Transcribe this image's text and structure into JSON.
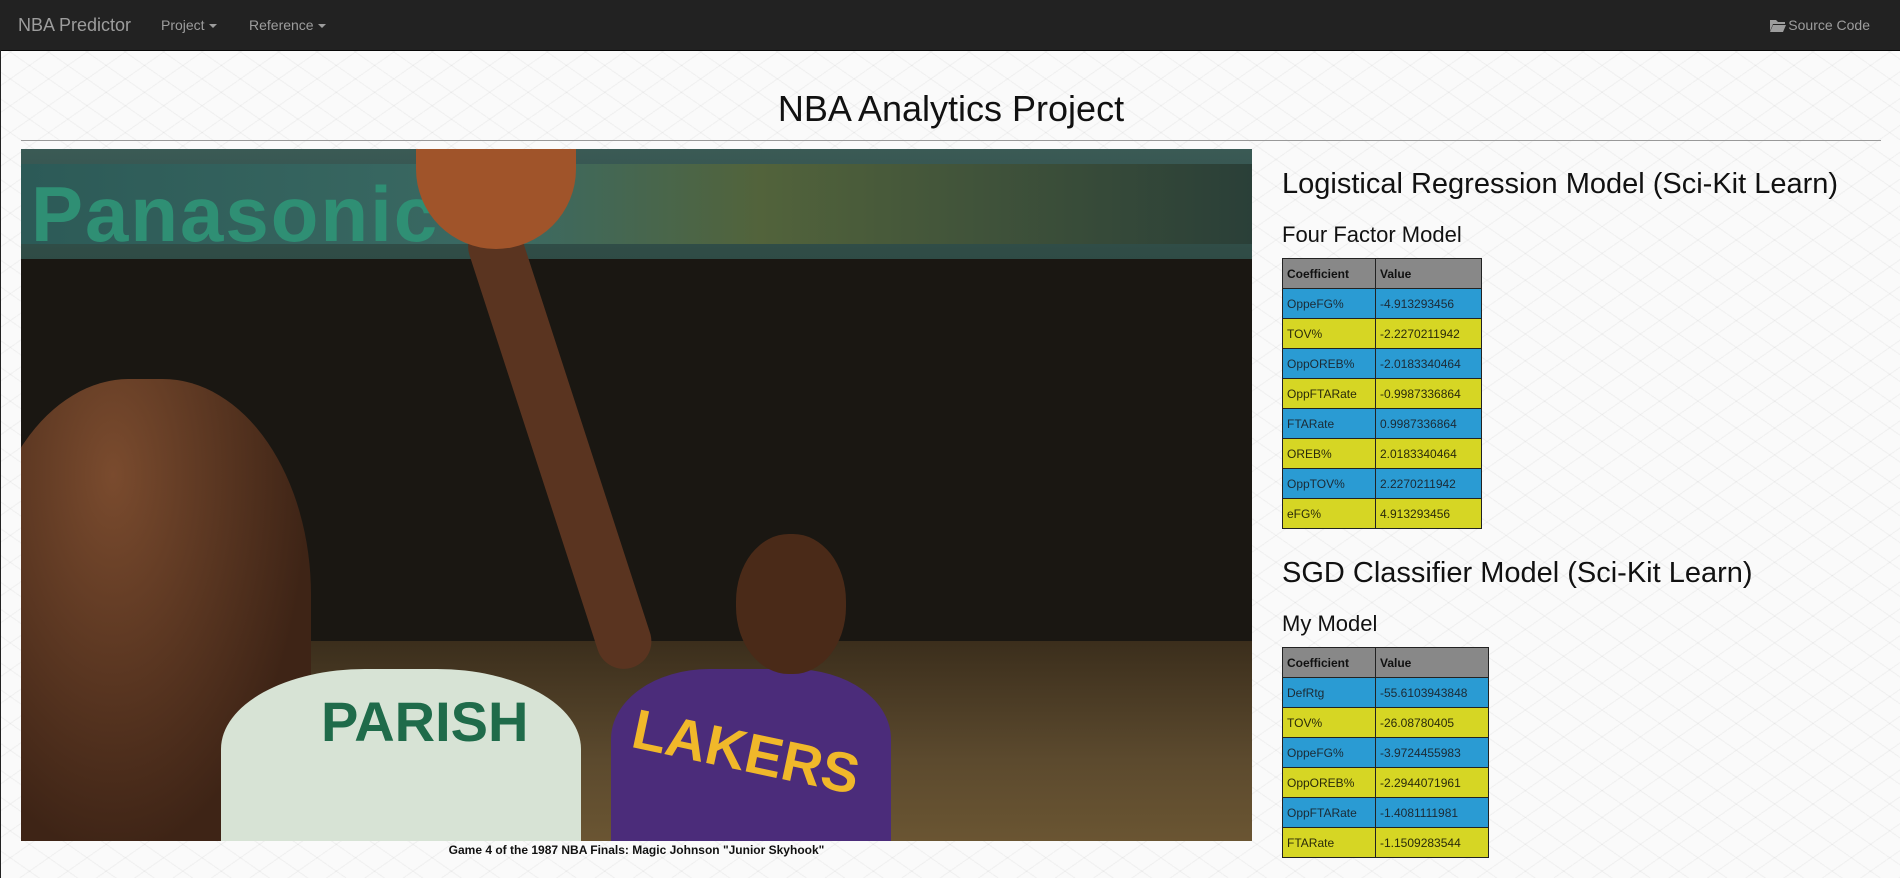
{
  "navbar": {
    "brand": "NBA Predictor",
    "items": [
      {
        "label": "Project"
      },
      {
        "label": "Reference"
      }
    ],
    "source_label": "Source Code"
  },
  "page_title": "NBA Analytics Project",
  "photo": {
    "caption": "Game 4 of the 1987 NBA Finals: Magic Johnson \"Junior Skyhook\"",
    "banner_text": "Panasonic",
    "jersey_text": "PARISH",
    "lakers_text": "LAKERS"
  },
  "logistic": {
    "title": "Logistical Regression Model (Sci-Kit Learn)",
    "subtitle": "Four Factor Model",
    "headers": [
      "Coefficient",
      "Value"
    ],
    "rows": [
      [
        "OppeFG%",
        "-4.913293456"
      ],
      [
        "TOV%",
        "-2.2270211942"
      ],
      [
        "OppOREB%",
        "-2.0183340464"
      ],
      [
        "OppFTARate",
        "-0.9987336864"
      ],
      [
        "FTARate",
        "0.9987336864"
      ],
      [
        "OREB%",
        "2.0183340464"
      ],
      [
        "OppTOV%",
        "2.2270211942"
      ],
      [
        "eFG%",
        "4.913293456"
      ]
    ]
  },
  "sgd": {
    "title": "SGD Classifier Model (Sci-Kit Learn)",
    "subtitle": "My Model",
    "headers": [
      "Coefficient",
      "Value"
    ],
    "rows": [
      [
        "DefRtg",
        "-55.6103943848"
      ],
      [
        "TOV%",
        "-26.08780405"
      ],
      [
        "OppeFG%",
        "-3.9724455983"
      ],
      [
        "OppOREB%",
        "-2.2944071961"
      ],
      [
        "OppFTARate",
        "-1.4081111981"
      ],
      [
        "FTARate",
        "-1.1509283544"
      ]
    ]
  },
  "colors": {
    "navbar": "#222222",
    "row_blue": "#2a9bd3",
    "row_yellow": "#d6d624",
    "header_gray": "#888888"
  },
  "icons": {
    "source": "folder-open-icon"
  }
}
